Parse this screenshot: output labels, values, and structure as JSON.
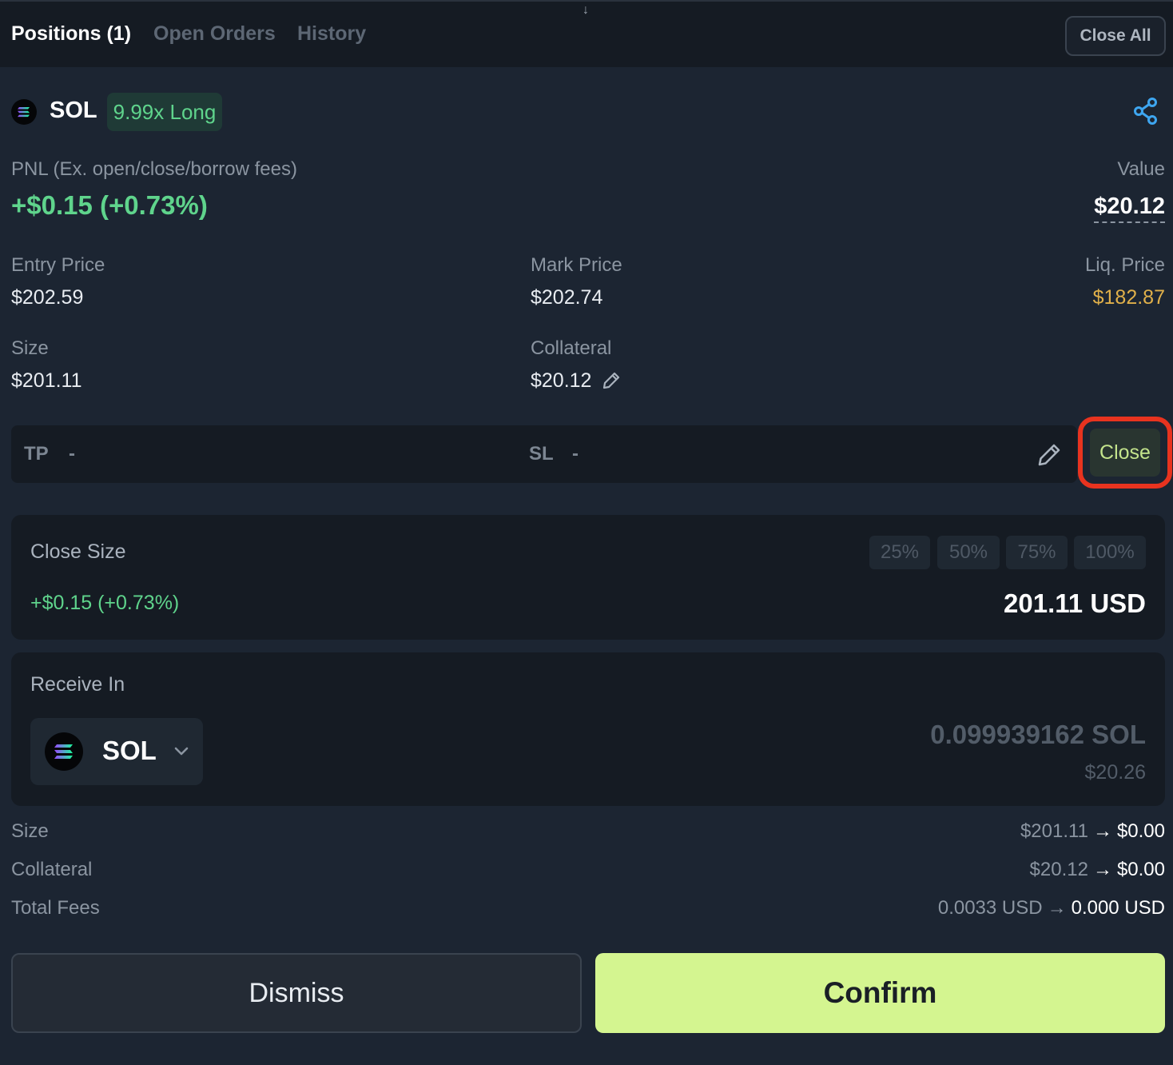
{
  "header": {
    "tabs": [
      {
        "label": "Positions",
        "count": "(1)"
      },
      {
        "label": "Open Orders"
      },
      {
        "label": "History"
      }
    ],
    "close_all_label": "Close All"
  },
  "position": {
    "token": "SOL",
    "leverage_badge": "9.99x Long",
    "pnl_label": "PNL (Ex. open/close/borrow fees)",
    "pnl_value": "+$0.15 (+0.73%)",
    "value_label": "Value",
    "value": "$20.12",
    "entry_price_label": "Entry Price",
    "entry_price": "$202.59",
    "mark_price_label": "Mark Price",
    "mark_price": "$202.74",
    "liq_price_label": "Liq. Price",
    "liq_price": "$182.87",
    "size_label": "Size",
    "size": "$201.11",
    "collateral_label": "Collateral",
    "collateral": "$20.12"
  },
  "tpsl": {
    "tp_label": "TP",
    "tp_value": "-",
    "sl_label": "SL",
    "sl_value": "-"
  },
  "close_button_label": "Close",
  "close_size": {
    "title": "Close Size",
    "percent_options": [
      "25%",
      "50%",
      "75%",
      "100%"
    ],
    "pnl": "+$0.15 (+0.73%)",
    "amount": "201.11 USD"
  },
  "receive": {
    "title": "Receive In",
    "selected_token": "SOL",
    "amount": "0.099939162 SOL",
    "usd_value": "$20.26"
  },
  "summary": [
    {
      "label": "Size",
      "from": "$201.11",
      "to": "$0.00"
    },
    {
      "label": "Collateral",
      "from": "$20.12",
      "to": "$0.00"
    },
    {
      "label": "Total Fees",
      "from": "0.0033 USD",
      "to": "0.000 USD"
    }
  ],
  "arrow_glyph": "→",
  "actions": {
    "dismiss_label": "Dismiss",
    "confirm_label": "Confirm"
  },
  "colors": {
    "background": "#1c2532",
    "panel": "#151b23",
    "profit_green": "#5fd48c",
    "liq_amber": "#e0b04a",
    "confirm_bg": "#d4f590",
    "highlight_red": "#e8331f",
    "share_blue": "#3ea6f0"
  },
  "icons": [
    "down-arrow-icon",
    "sol-logo-icon",
    "share-icon",
    "pencil-icon",
    "chevron-down-icon"
  ]
}
